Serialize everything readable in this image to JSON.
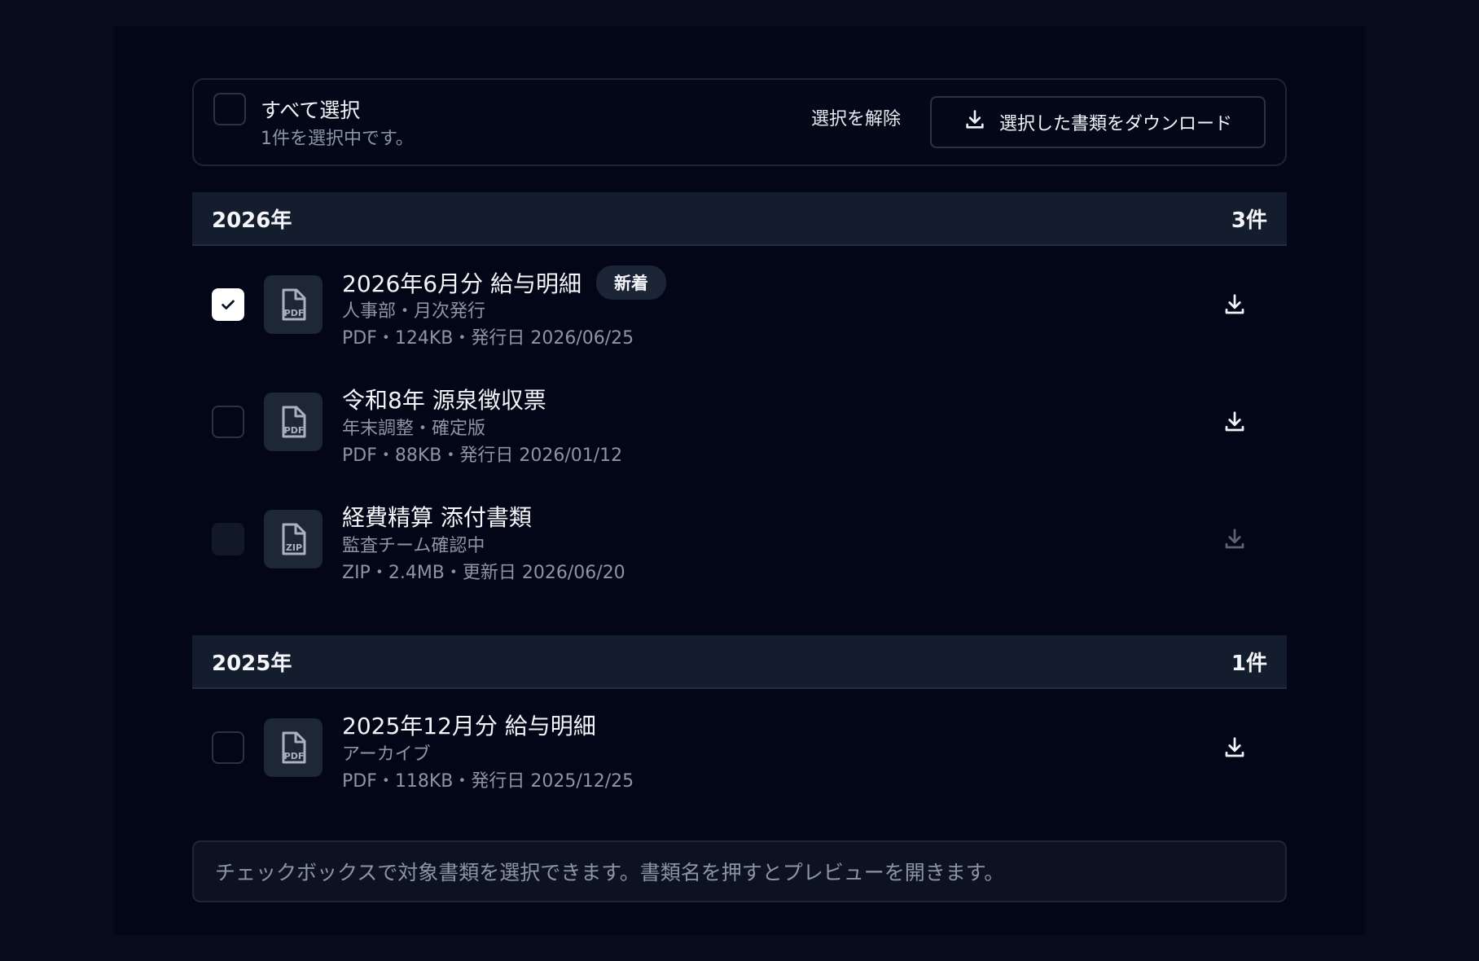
{
  "toolbar": {
    "select_all_label": "すべて選択",
    "selection_status": "1件を選択中です。",
    "clear_label": "選択を解除",
    "download_selected_label": "選択した書類をダウンロード"
  },
  "groups": [
    {
      "year": "2026年",
      "count": "3件",
      "items": [
        {
          "title": "2026年6月分 給与明細",
          "badge": "新着",
          "subtitle": "人事部・月次発行",
          "meta": "PDF・124KB・発行日 2026/06/25",
          "file_type": "PDF",
          "checked": true
        },
        {
          "title": "令和8年 源泉徴収票",
          "subtitle": "年末調整・確定版",
          "meta": "PDF・88KB・発行日 2026/01/12",
          "file_type": "PDF",
          "checked": false
        },
        {
          "title": "経費精算 添付書類",
          "subtitle": "監査チーム確認中",
          "meta": "ZIP・2.4MB・更新日 2026/06/20",
          "file_type": "ZIP",
          "checked": false,
          "disabled": true
        }
      ]
    },
    {
      "year": "2025年",
      "count": "1件",
      "items": [
        {
          "title": "2025年12月分 給与明細",
          "subtitle": "アーカイブ",
          "meta": "PDF・118KB・発行日 2025/12/25",
          "file_type": "PDF",
          "checked": false
        }
      ]
    }
  ],
  "footer_note": "チェックボックスで対象書類を選択できます。書類名を押すとプレビューを開きます。",
  "colors": {
    "background": "#070c1a",
    "panel": "#020617",
    "group_header": "#141d2d",
    "muted_text": "#8c95a6"
  }
}
